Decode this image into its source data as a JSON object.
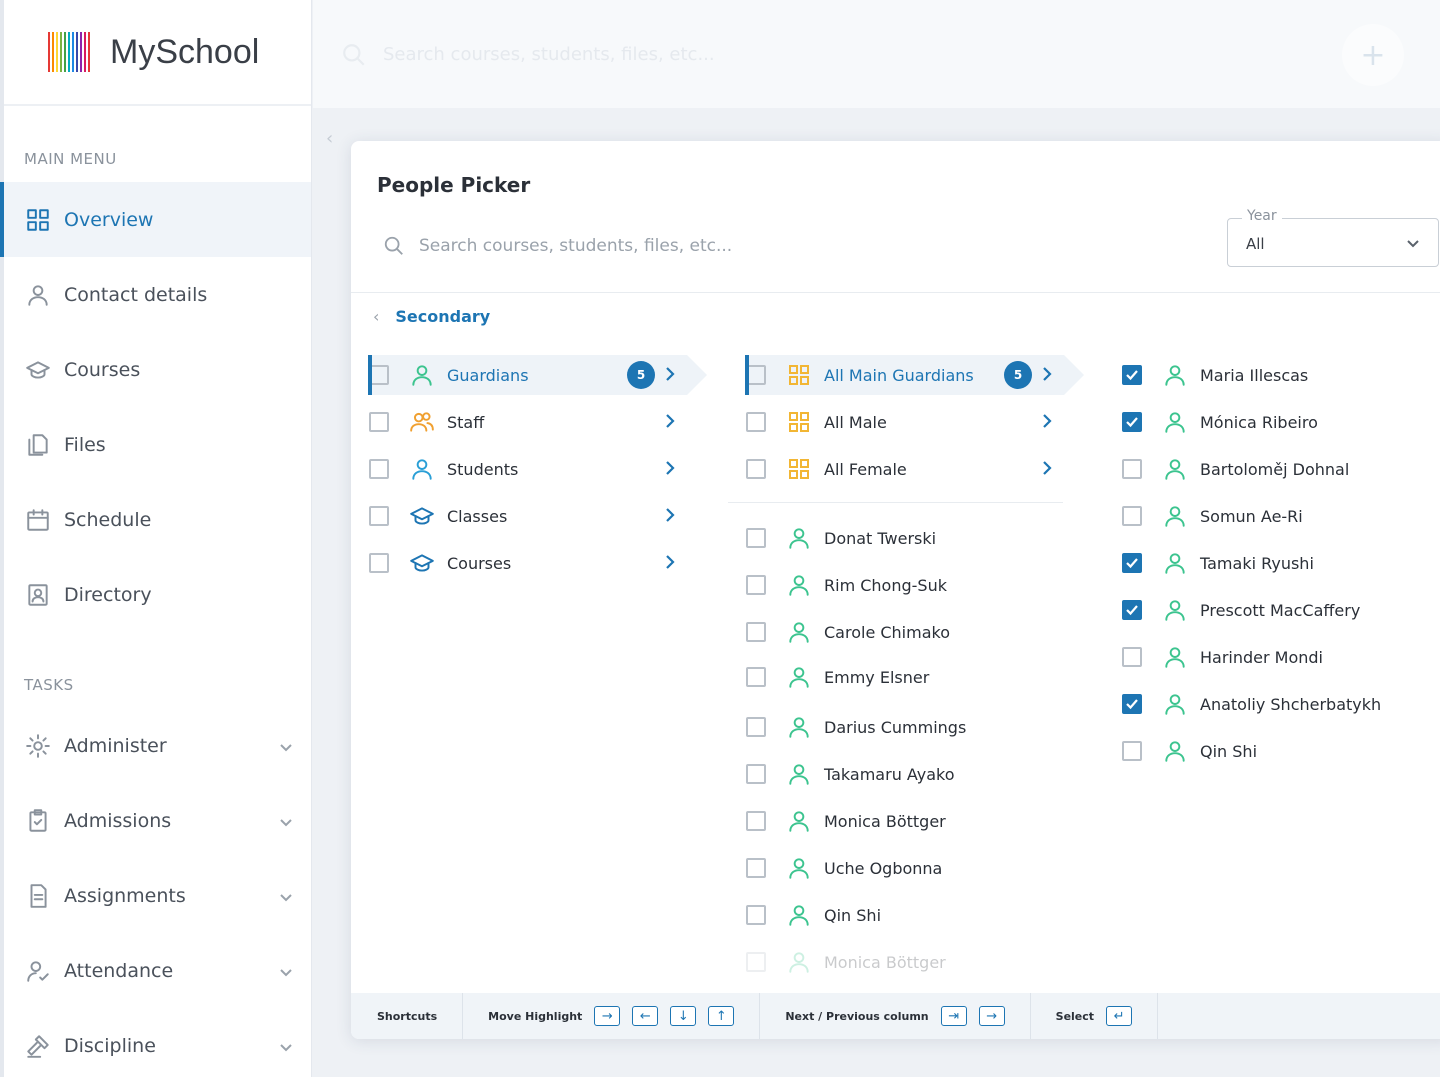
{
  "app": {
    "name": "MySchool",
    "logo_colors": [
      "#e53935",
      "#fb8c00",
      "#fdd835",
      "#7cb342",
      "#43a047",
      "#00acc1",
      "#1e88e5",
      "#3949ab",
      "#8e24aa",
      "#d81b60",
      "#e53935"
    ]
  },
  "topbar": {
    "search_placeholder": "Search courses, students, files, etc...",
    "add_icon": "plus-icon"
  },
  "sidebar": {
    "main_menu_title": "MAIN MENU",
    "main_items": [
      {
        "label": "Overview",
        "icon": "grid-icon",
        "active": true
      },
      {
        "label": "Contact details",
        "icon": "person-icon"
      },
      {
        "label": "Courses",
        "icon": "graduation-cap-icon"
      },
      {
        "label": "Files",
        "icon": "files-icon"
      },
      {
        "label": "Schedule",
        "icon": "calendar-icon"
      },
      {
        "label": "Directory",
        "icon": "directory-icon"
      }
    ],
    "tasks_title": "TASKS",
    "task_items": [
      {
        "label": "Administer",
        "icon": "gear-icon"
      },
      {
        "label": "Admissions",
        "icon": "clipboard-icon"
      },
      {
        "label": "Assignments",
        "icon": "document-icon"
      },
      {
        "label": "Attendance",
        "icon": "person-check-icon"
      },
      {
        "label": "Discipline",
        "icon": "gavel-icon"
      }
    ]
  },
  "picker": {
    "title": "People Picker",
    "search_placeholder": "Search courses, students, files, etc...",
    "year": {
      "legend": "Year",
      "value": "All"
    },
    "breadcrumb": "Secondary",
    "col1": [
      {
        "label": "Guardians",
        "icon": "person-icon",
        "badge": "5",
        "highlight": true
      },
      {
        "label": "Staff",
        "icon": "people-icon"
      },
      {
        "label": "Students",
        "icon": "person-icon"
      },
      {
        "label": "Classes",
        "icon": "graduation-cap-icon"
      },
      {
        "label": "Courses",
        "icon": "graduation-cap-icon"
      }
    ],
    "col2_groups": [
      {
        "label": "All Main Guardians",
        "badge": "5",
        "highlight": true
      },
      {
        "label": "All Male"
      },
      {
        "label": "All Female"
      }
    ],
    "col2_people": [
      "Donat Twerski",
      "Rim Chong-Suk",
      "Carole Chimako",
      "Emmy Elsner",
      "Darius Cummings",
      "Takamaru Ayako",
      "Monica Böttger",
      "Uche Ogbonna",
      "Qin Shi",
      "Monica Böttger"
    ],
    "col3_people": [
      {
        "name": "Maria Illescas",
        "checked": true
      },
      {
        "name": "Mónica Ribeiro",
        "checked": true
      },
      {
        "name": "Bartoloměj Dohnal",
        "checked": false
      },
      {
        "name": "Somun Ae-Ri",
        "checked": false
      },
      {
        "name": "Tamaki Ryushi",
        "checked": true
      },
      {
        "name": "Prescott MacCaffery",
        "checked": true
      },
      {
        "name": "Harinder Mondi",
        "checked": false
      },
      {
        "name": "Anatoliy Shcherbatykh",
        "checked": true
      },
      {
        "name": "Qin Shi",
        "checked": false
      }
    ],
    "shortcuts": {
      "label": "Shortcuts",
      "move_label": "Move Highlight",
      "move_keys": [
        "→",
        "←",
        "↓",
        "↑"
      ],
      "column_label": "Next / Previous column",
      "column_keys": [
        "⇥",
        "→"
      ],
      "select_label": "Select",
      "select_key": "↵"
    }
  },
  "colors": {
    "accent": "#1d75b3",
    "person_green": "#3cc48f",
    "staff_orange": "#f0a030",
    "grid_yellow": "#f2b634"
  }
}
